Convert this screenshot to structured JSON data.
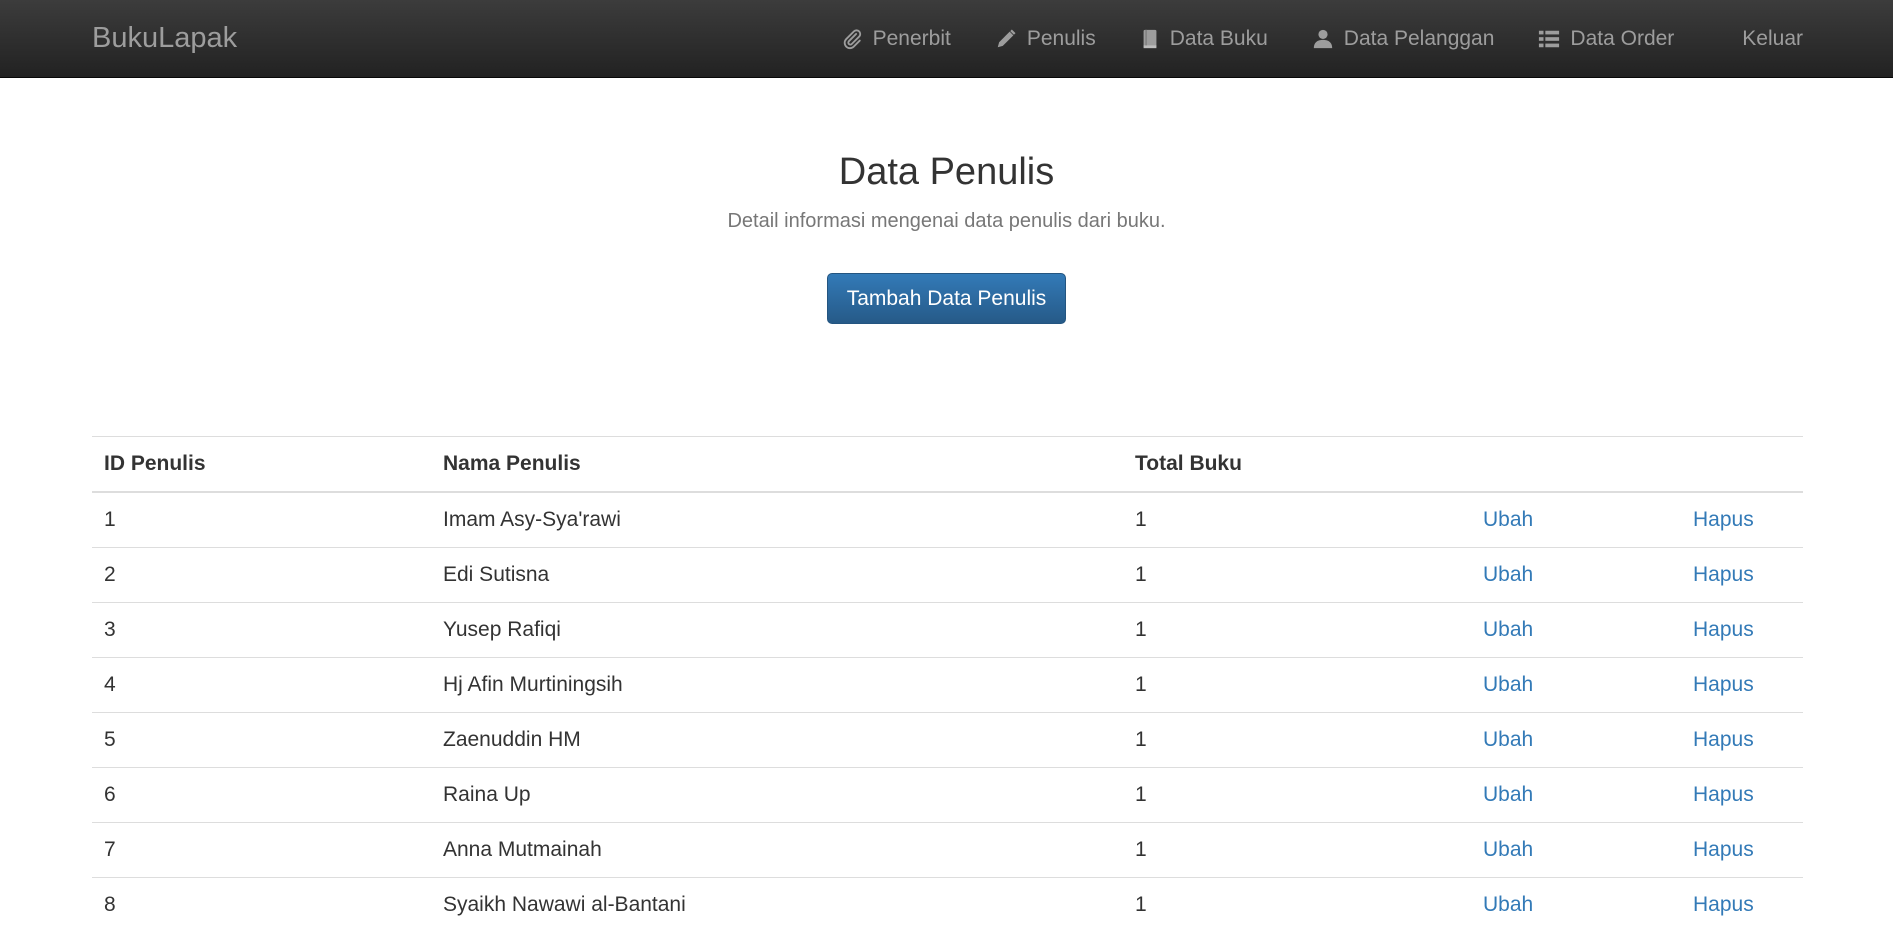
{
  "navbar": {
    "brand": "BukuLapak",
    "items": [
      {
        "label": "Penerbit",
        "icon": "paperclip-icon"
      },
      {
        "label": "Penulis",
        "icon": "pencil-icon"
      },
      {
        "label": "Data Buku",
        "icon": "book-icon"
      },
      {
        "label": "Data Pelanggan",
        "icon": "user-icon"
      },
      {
        "label": "Data Order",
        "icon": "list-icon"
      }
    ],
    "logout": "Keluar"
  },
  "hero": {
    "title": "Data Penulis",
    "subtitle": "Detail informasi mengenai data penulis dari buku.",
    "add_button": "Tambah Data Penulis"
  },
  "table": {
    "headers": [
      "ID Penulis",
      "Nama Penulis",
      "Total Buku",
      "",
      ""
    ],
    "rows": [
      {
        "id": "1",
        "name": "Imam Asy-Sya'rawi",
        "total": "1",
        "edit": "Ubah",
        "delete": "Hapus"
      },
      {
        "id": "2",
        "name": "Edi Sutisna",
        "total": "1",
        "edit": "Ubah",
        "delete": "Hapus"
      },
      {
        "id": "3",
        "name": "Yusep Rafiqi",
        "total": "1",
        "edit": "Ubah",
        "delete": "Hapus"
      },
      {
        "id": "4",
        "name": "Hj Afin Murtiningsih",
        "total": "1",
        "edit": "Ubah",
        "delete": "Hapus"
      },
      {
        "id": "5",
        "name": "Zaenuddin HM",
        "total": "1",
        "edit": "Ubah",
        "delete": "Hapus"
      },
      {
        "id": "6",
        "name": "Raina Up",
        "total": "1",
        "edit": "Ubah",
        "delete": "Hapus"
      },
      {
        "id": "7",
        "name": "Anna Mutmainah",
        "total": "1",
        "edit": "Ubah",
        "delete": "Hapus"
      },
      {
        "id": "8",
        "name": "Syaikh Nawawi al-Bantani",
        "total": "1",
        "edit": "Ubah",
        "delete": "Hapus"
      }
    ]
  },
  "colors": {
    "navbar_top": "#3c3c3c",
    "navbar_bottom": "#222222",
    "nav_text": "#9d9d9d",
    "primary": "#337ab7",
    "link": "#337ab7"
  }
}
